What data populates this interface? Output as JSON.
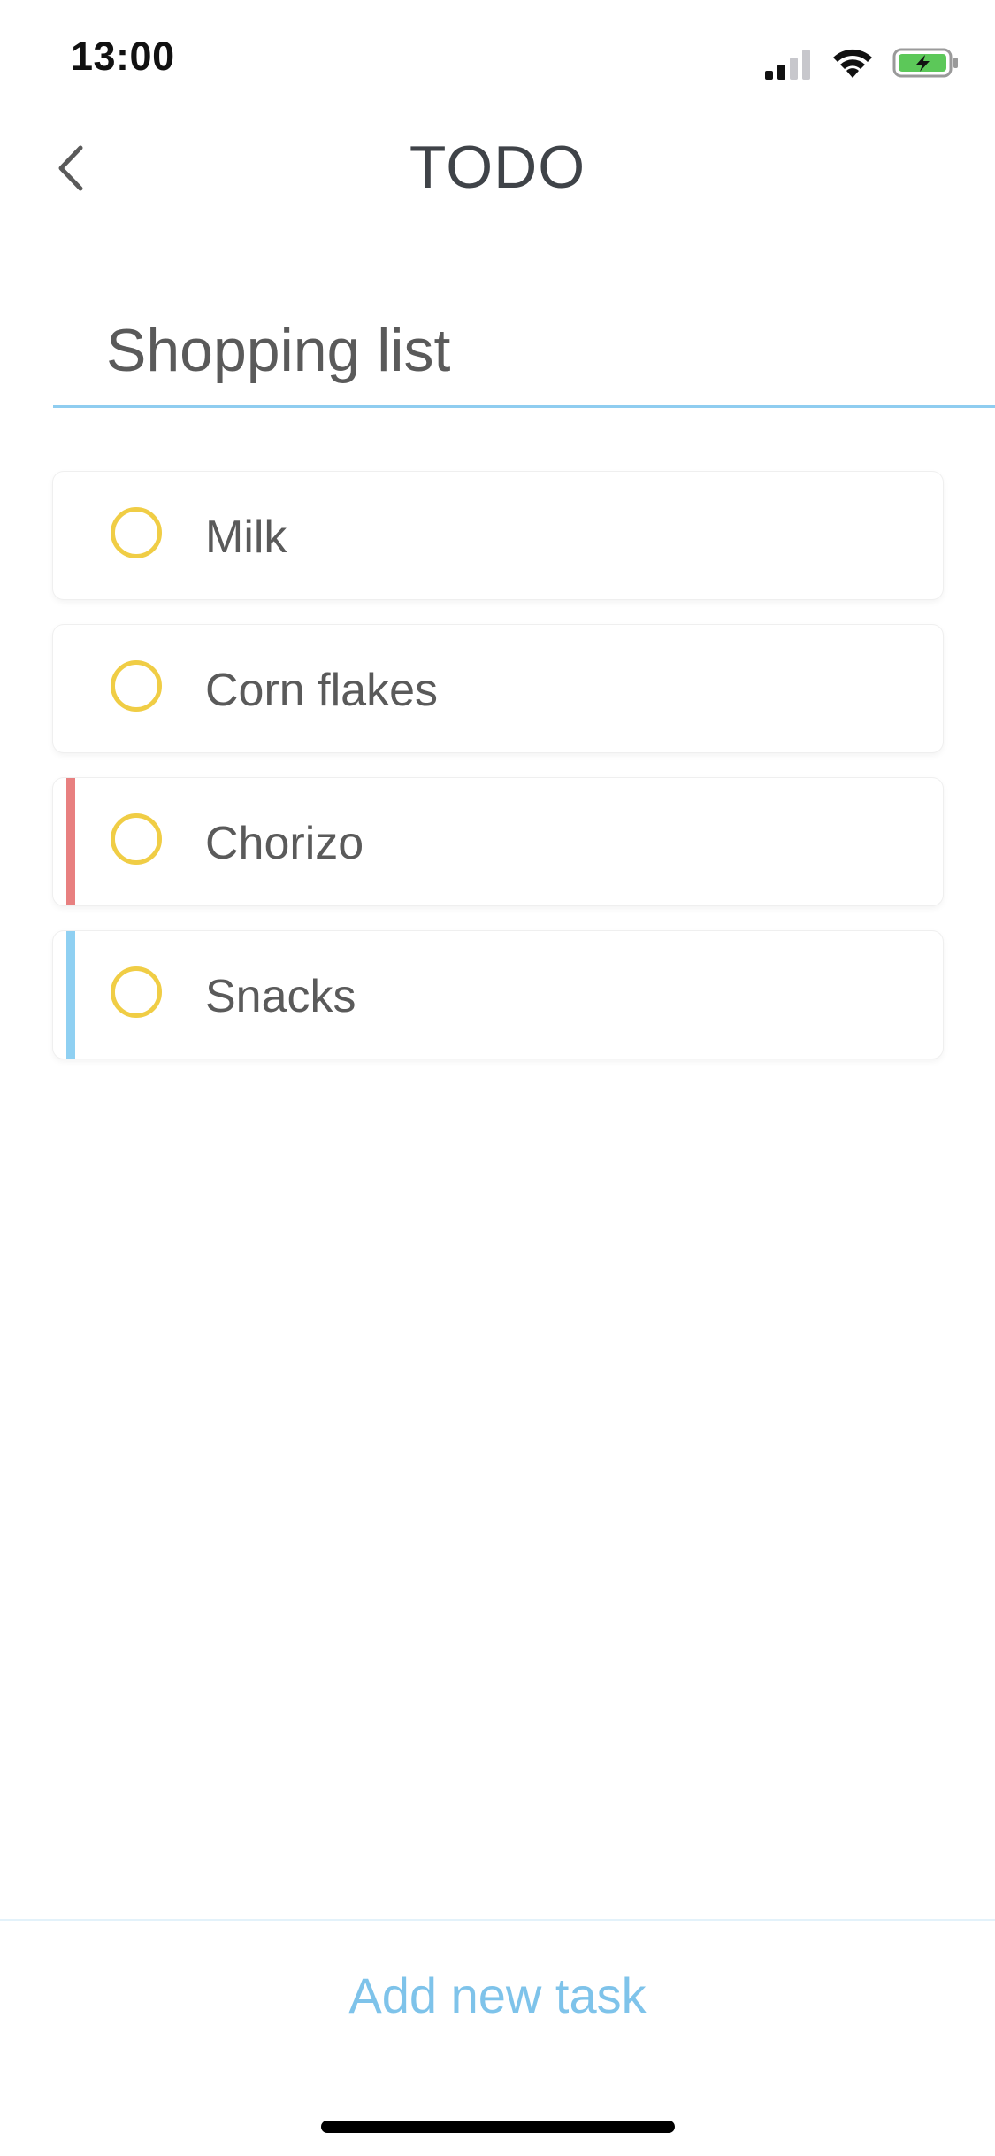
{
  "status_bar": {
    "time": "13:00",
    "icons": [
      "cellular-signal-icon",
      "wifi-icon",
      "battery-charging-icon"
    ]
  },
  "nav": {
    "title": "TODO",
    "back_icon": "chevron-left-icon"
  },
  "list": {
    "title_value": "Shopping list",
    "underline_color": "#8fcdf0"
  },
  "tasks": [
    {
      "label": "Milk",
      "accent_color": ""
    },
    {
      "label": "Corn flakes",
      "accent_color": ""
    },
    {
      "label": "Chorizo",
      "accent_color": "#e88080"
    },
    {
      "label": "Snacks",
      "accent_color": "#8fd0f2"
    }
  ],
  "checkbox_color": "#f0cd45",
  "footer": {
    "add_task_label": "Add new task",
    "accent_color": "#7ec3ea"
  }
}
